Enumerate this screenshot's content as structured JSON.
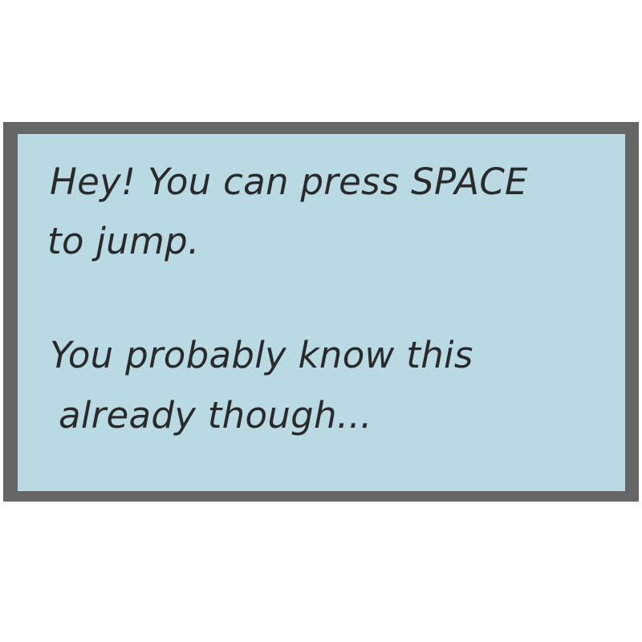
{
  "dialog": {
    "lines": [
      "Hey! You can press SPACE",
      "to jump.",
      "You probably know this",
      "already though..."
    ]
  },
  "colors": {
    "background": "#ffffff",
    "frame": "#666666",
    "panel": "#badae3",
    "text": "#2a2a2a"
  }
}
